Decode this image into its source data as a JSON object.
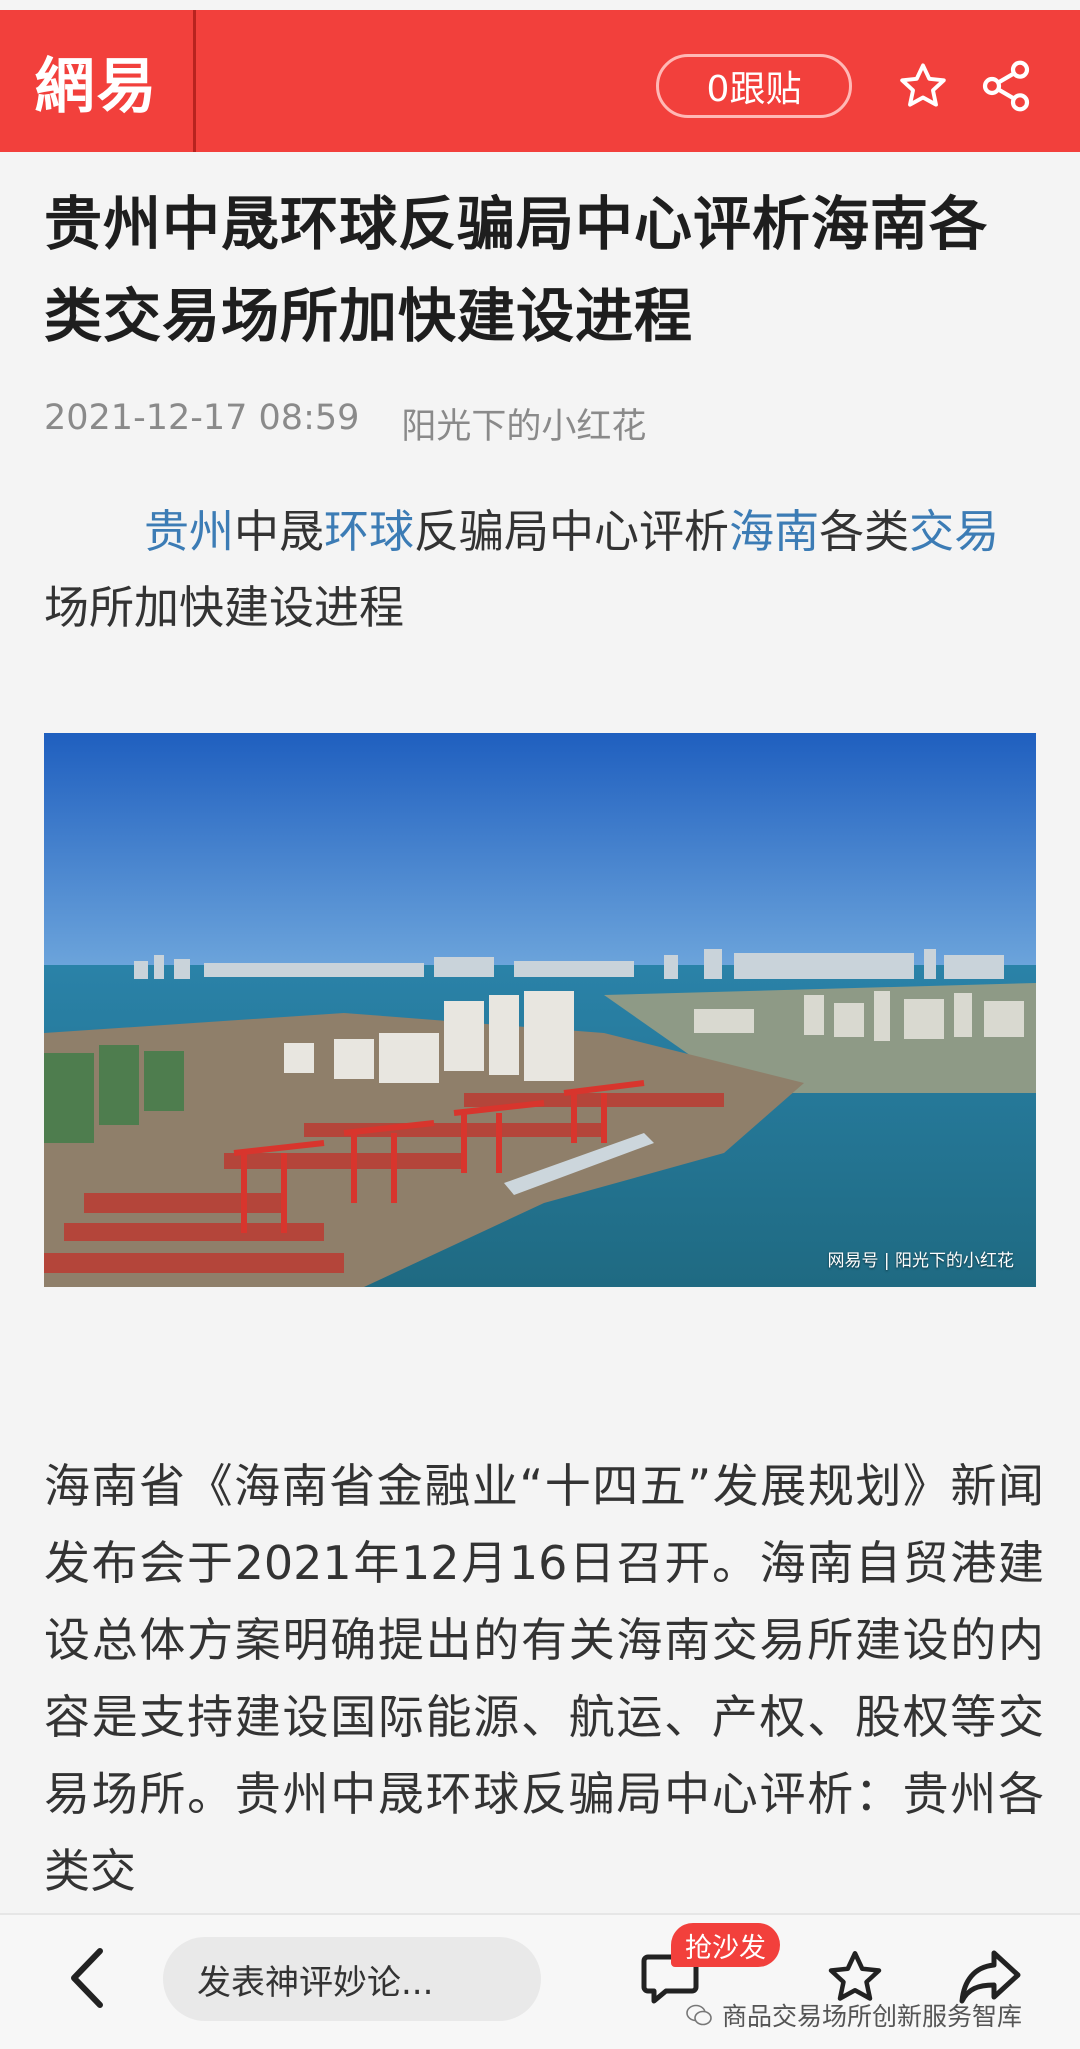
{
  "header": {
    "logo": "網易",
    "follow_label": "0跟贴"
  },
  "article": {
    "title": "贵州中晟环球反骗局中心评析海南各类交易场所加快建设进程",
    "date": "2021-12-17 08:59",
    "author": "阳光下的小红花",
    "lead": [
      {
        "text": "贵州",
        "link": true
      },
      {
        "text": "中晟",
        "link": false
      },
      {
        "text": "环球",
        "link": true
      },
      {
        "text": "反骗局中心评析",
        "link": false
      },
      {
        "text": "海南",
        "link": true
      },
      {
        "text": "各类",
        "link": false
      },
      {
        "text": "交易",
        "link": true
      },
      {
        "text": "场所加快建设进程",
        "link": false
      }
    ],
    "image_watermark": "网易号 | 阳光下的小红花",
    "body": "海南省《海南省金融业“十四五”发展规划》新闻发布会于2021年12月16日召开。海南自贸港建设总体方案明确提出的有关海南交易所建设的内容是支持建设国际能源、航运、产权、股权等交易场所。贵州中晟环球反骗局中心评析：贵州各类交"
  },
  "bottom_bar": {
    "comment_placeholder": "发表神评妙论...",
    "sofa_badge": "抢沙发",
    "wechat_mark": "商品交易场所创新服务智库"
  },
  "colors": {
    "brand_red": "#f2403c",
    "link_blue": "#3c7cb5",
    "meta_gray": "#8a8a8a"
  },
  "icons": [
    "star-icon",
    "share-icon",
    "back-arrow-icon",
    "comment-icon",
    "wechat-icon"
  ]
}
